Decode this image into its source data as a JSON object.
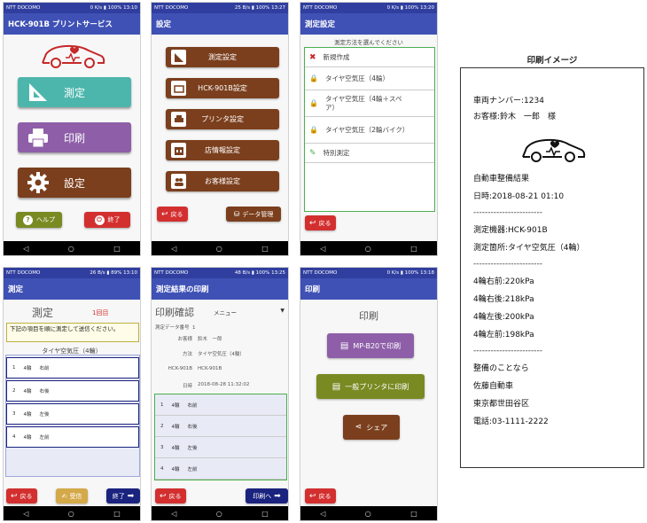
{
  "status": {
    "p1": {
      "carrier": "NTT DOCOMO",
      "right": "0 K/s ▮ 100% 13:10"
    },
    "p2": {
      "carrier": "NTT DOCOMO",
      "right": "25 B/s ▮ 100% 13:27"
    },
    "p3": {
      "carrier": "NTT DOCOMO",
      "right": "0 K/s ▮ 100% 13:20"
    },
    "p4": {
      "carrier": "NTT DOCOMO",
      "right": "26 B/s ▮ 89% 13:10"
    },
    "p5": {
      "carrier": "NTT DOCOMO",
      "right": "48 B/s ▮ 100% 13:25"
    },
    "p6": {
      "carrier": "NTT DOCOMO",
      "right": "0 K/s ▮ 100% 13:18"
    }
  },
  "screen1": {
    "title": "HCK-901B プリントサービス",
    "measure_label": "測定",
    "print_label": "印刷",
    "settings_label": "設定",
    "help_label": "ヘルプ",
    "exit_label": "終了"
  },
  "screen2": {
    "title": "設定",
    "buttons": [
      "測定設定",
      "HCK-901B設定",
      "プリンタ設定",
      "店情報設定",
      "お客様設定"
    ],
    "back_label": "戻る",
    "data_label": "データ管理"
  },
  "screen3": {
    "title": "測定設定",
    "prompt": "測定方法を選んでください",
    "items": [
      "新規作成",
      "タイヤ空気圧（4輪）",
      "タイヤ空気圧（4輪＋スペア）",
      "タイヤ空気圧（2輪バイク）",
      "特別測定"
    ],
    "back_label": "戻る"
  },
  "screen4": {
    "title": "測定",
    "heading": "測定",
    "count": "1回目",
    "instruction": "下記の項目を順に測定して送信ください。",
    "subtitle": "タイヤ空気圧（4輪）",
    "rows": [
      {
        "no": "1",
        "name": "4輪",
        "pos": "右前"
      },
      {
        "no": "2",
        "name": "4輪",
        "pos": "右後"
      },
      {
        "no": "3",
        "name": "4輪",
        "pos": "左後"
      },
      {
        "no": "4",
        "name": "4輪",
        "pos": "左前"
      }
    ],
    "back_label": "戻る",
    "receive_label": "受信",
    "finish_label": "終了"
  },
  "screen5": {
    "title": "測定結果の印刷",
    "heading": "印刷確認",
    "menu_label": "メニュー",
    "data_no_label": "測定データ番号",
    "data_no": "1",
    "fields": [
      {
        "label": "お客様",
        "value": "鈴木　一郎"
      },
      {
        "label": "方法",
        "value": "タイヤ空気圧（4輪）"
      },
      {
        "label": "HCK-901B",
        "value": "HCK-901B"
      },
      {
        "label": "日時",
        "value": "2018-08-28 11:32:02"
      }
    ],
    "rows": [
      {
        "no": "1",
        "name": "4輪",
        "pos": "右前"
      },
      {
        "no": "2",
        "name": "4輪",
        "pos": "右後"
      },
      {
        "no": "3",
        "name": "4輪",
        "pos": "左後"
      },
      {
        "no": "4",
        "name": "4輪",
        "pos": "左前"
      }
    ],
    "back_label": "戻る",
    "print_label": "印刷へ"
  },
  "screen6": {
    "title": "印刷",
    "heading": "印刷",
    "mp_label": "MP-B20で印刷",
    "general_label": "一般プリンタに印刷",
    "share_label": "シェア",
    "back_label": "戻る"
  },
  "receipt": {
    "heading": "印刷イメージ",
    "plate": "車両ナンバー:1234",
    "customer": "お客様:鈴木　一郎　様",
    "result_title": "自動車整備結果",
    "datetime": "日時:2018-08-21 01:10",
    "divider": "------------------------",
    "device": "測定機器:HCK-901B",
    "location": "測定箇所:タイヤ空気圧（4輪）",
    "values": [
      "4輪右前:220kPa",
      "4輪右後:218kPa",
      "4輪左後:200kPa",
      "4輪左前:198kPa"
    ],
    "contact_title": "整備のことなら",
    "shop": "佐藤自動車",
    "address": "東京都世田谷区",
    "phone": "電話:03-1111-2222"
  },
  "colors": {
    "appbar": "#3f51b5",
    "measure": "#4db6ac",
    "print": "#8e5fa8",
    "settings": "#7b3f1d",
    "help": "#7a8a23",
    "exit": "#d32f2f",
    "finish": "#1a237e"
  },
  "icons": [
    "car-heart-logo-icon",
    "triangle-ruler-icon",
    "printer-icon",
    "gear-icon",
    "question-icon",
    "power-icon",
    "back-arrow-icon",
    "database-icon",
    "tools-icon",
    "lock-icon",
    "pencil-icon",
    "share-icon",
    "shop-icon",
    "people-icon",
    "forward-arrow-icon",
    "dropdown-icon"
  ]
}
